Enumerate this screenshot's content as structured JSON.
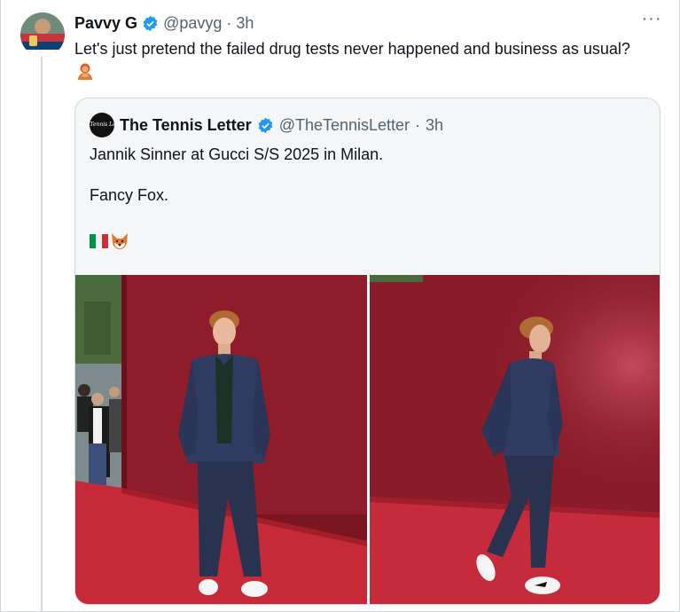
{
  "tweet": {
    "author_name": "Pavvy G",
    "handle": "@pavyg",
    "separator": "·",
    "time": "3h",
    "text": "Let's just pretend the failed drug tests never happened and business as usual?",
    "more_label": "···"
  },
  "quoted": {
    "author_name": "The Tennis Letter",
    "handle": "@TheTennisLetter",
    "separator": "·",
    "time": "3h",
    "avatar_text": "The Tennis Letter",
    "line1": "Jannik Sinner at Gucci S/S 2025 in Milan.",
    "line2": "Fancy Fox.",
    "emojis": [
      "italy-flag",
      "fox-face"
    ],
    "photos": [
      "photo-left",
      "photo-right"
    ]
  },
  "colors": {
    "verified_blue": "#1d9bf0",
    "secondary_text": "#536471",
    "backdrop_red": "#8e1c2a",
    "carpet_red": "#c62a38"
  }
}
